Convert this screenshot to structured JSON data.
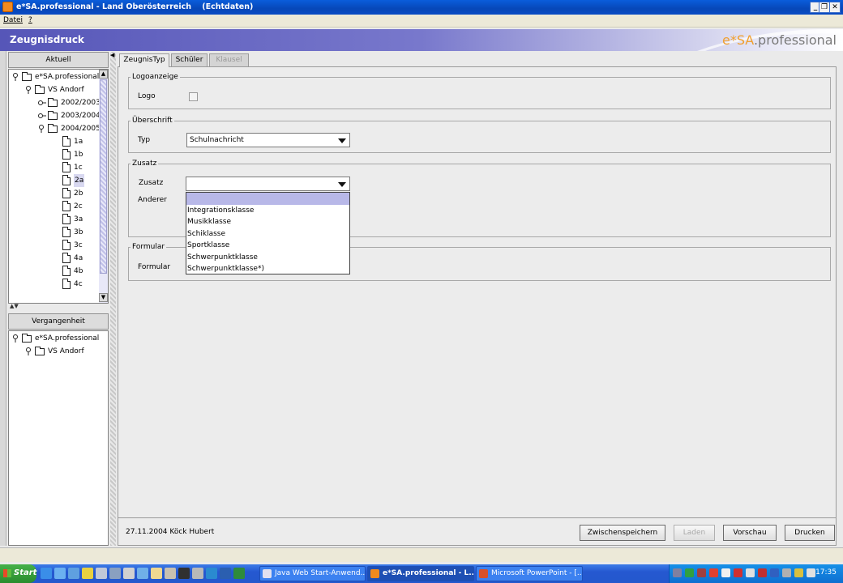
{
  "window": {
    "title": "e*SA.professional - Land Oberösterreich    (Echtdaten)"
  },
  "menu": {
    "items": [
      "Datei",
      "?"
    ]
  },
  "header": {
    "title": "Zeugnisdruck",
    "logo_brand": "e*SA",
    "logo_rest": ".professional"
  },
  "left_panel": {
    "aktuell": {
      "title": "Aktuell",
      "tree": [
        {
          "label": "e*SA.professional",
          "type": "folder"
        },
        {
          "label": "VS Andorf",
          "type": "folder"
        },
        {
          "label": "2002/2003",
          "type": "folder"
        },
        {
          "label": "2003/2004",
          "type": "folder"
        },
        {
          "label": "2004/2005",
          "type": "folder"
        },
        {
          "label": "1a",
          "type": "doc"
        },
        {
          "label": "1b",
          "type": "doc"
        },
        {
          "label": "1c",
          "type": "doc"
        },
        {
          "label": "2a",
          "type": "doc",
          "selected": true
        },
        {
          "label": "2b",
          "type": "doc"
        },
        {
          "label": "2c",
          "type": "doc"
        },
        {
          "label": "3a",
          "type": "doc"
        },
        {
          "label": "3b",
          "type": "doc"
        },
        {
          "label": "3c",
          "type": "doc"
        },
        {
          "label": "4a",
          "type": "doc"
        },
        {
          "label": "4b",
          "type": "doc"
        },
        {
          "label": "4c",
          "type": "doc"
        }
      ]
    },
    "vergangenheit": {
      "title": "Vergangenheit",
      "tree": [
        {
          "label": "e*SA.professional",
          "type": "folder"
        },
        {
          "label": "VS Andorf",
          "type": "folder"
        }
      ]
    }
  },
  "tabs": [
    {
      "label": "ZeugnisTyp",
      "state": "active"
    },
    {
      "label": "Schüler",
      "state": "normal"
    },
    {
      "label": "Klausel",
      "state": "disabled"
    }
  ],
  "form": {
    "logoanzeige": {
      "legend": "Logoanzeige",
      "logo_label": "Logo",
      "logo_checked": false
    },
    "ueberschrift": {
      "legend": "Überschrift",
      "typ_label": "Typ",
      "typ_value": "Schulnachricht"
    },
    "zusatz": {
      "legend": "Zusatz",
      "zusatz_label": "Zusatz",
      "zusatz_value": "",
      "anderer_label": "Anderer",
      "options": [
        "",
        "Integrationsklasse",
        "Musikklasse",
        "Schiklasse",
        "Sportklasse",
        "Schwerpunktklasse",
        "Schwerpunktklasse*)"
      ]
    },
    "formular": {
      "legend": "Formular",
      "formular_label": "Formular"
    }
  },
  "status": {
    "info": "27.11.2004 Köck Hubert",
    "buttons": {
      "zwischenspeichern": "Zwischenspeichern",
      "laden": "Laden",
      "vorschau": "Vorschau",
      "drucken": "Drucken"
    }
  },
  "taskbar": {
    "start": "Start",
    "tasks": [
      {
        "label": "Java Web Start-Anwend...",
        "active": false
      },
      {
        "label": "e*SA.professional - L...",
        "active": true
      },
      {
        "label": "Microsoft PowerPoint - [...",
        "active": false
      }
    ],
    "clock": "17:35"
  },
  "colors": {
    "header_purple": "#5656b8",
    "logo_orange": "#f0a030",
    "taskbar_blue": "#2558d0",
    "start_green": "#2a8c2e"
  }
}
